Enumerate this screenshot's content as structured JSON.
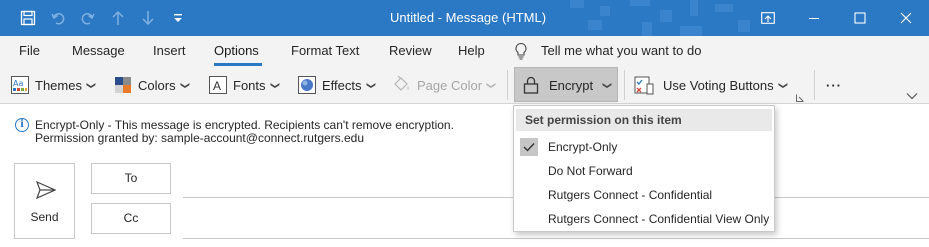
{
  "window": {
    "title": "Untitled  -  Message (HTML)"
  },
  "quick_access": {
    "icons": [
      "save-icon",
      "undo-icon",
      "redo-icon",
      "up-arrow-icon",
      "down-arrow-icon",
      "customize-icon"
    ]
  },
  "menu": {
    "tabs": [
      {
        "label": "File"
      },
      {
        "label": "Message"
      },
      {
        "label": "Insert"
      },
      {
        "label": "Options",
        "active": true
      },
      {
        "label": "Format Text"
      },
      {
        "label": "Review"
      },
      {
        "label": "Help"
      }
    ],
    "tell_me": "Tell me what you want to do"
  },
  "ribbon": {
    "themes": "Themes",
    "colors": "Colors",
    "fonts": "Fonts",
    "effects": "Effects",
    "page_color": "Page Color",
    "encrypt": "Encrypt",
    "voting": "Use Voting Buttons",
    "more": "···"
  },
  "info": {
    "line1": "Encrypt-Only - This message is encrypted. Recipients can't remove encryption.",
    "line2": "Permission granted by: sample-account@connect.rutgers.edu"
  },
  "compose": {
    "send": "Send",
    "to": "To",
    "cc": "Cc"
  },
  "dropdown": {
    "header": "Set permission on this item",
    "items": [
      {
        "label": "Encrypt-Only",
        "selected": true
      },
      {
        "label": "Do Not Forward"
      },
      {
        "label": "Rutgers Connect - Confidential"
      },
      {
        "label": "Rutgers Connect - Confidential View Only"
      }
    ]
  },
  "colors": {
    "titlebar": "#2b78c4",
    "accent": "#2b78c4"
  }
}
